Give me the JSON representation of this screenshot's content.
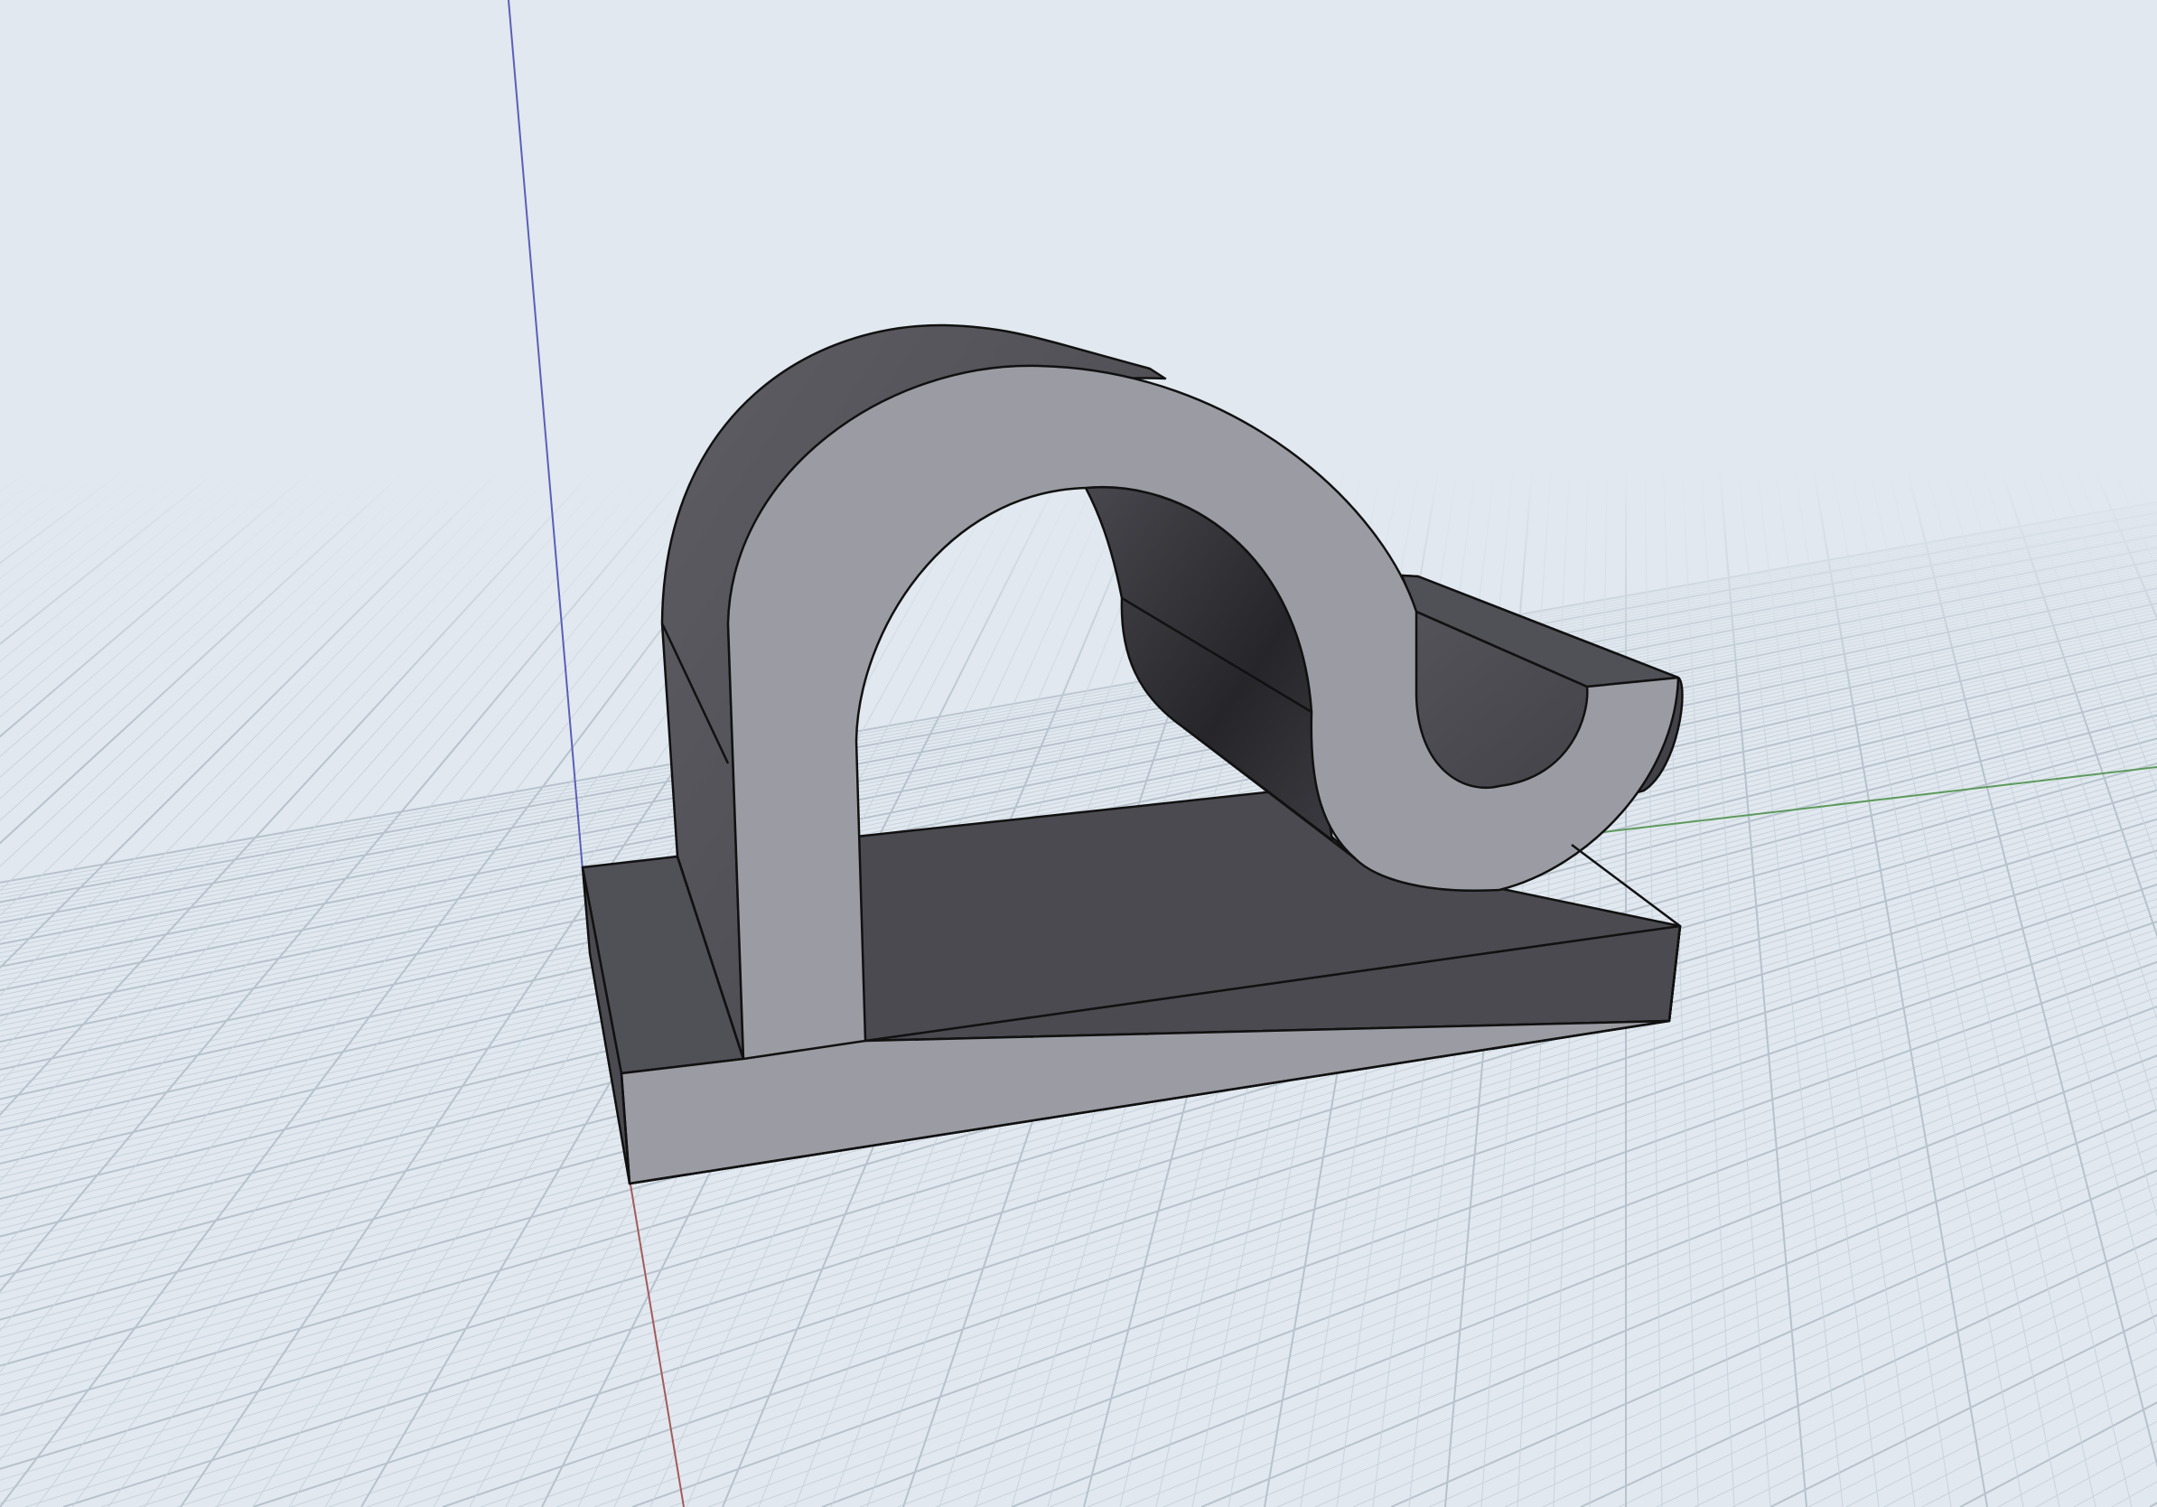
{
  "viewport": {
    "background_color": "#e1e8ef",
    "grid": {
      "visible": true,
      "minor_line_color": "#c9d3dc",
      "major_line_color": "#b7c2cc"
    },
    "axes": {
      "x_axis_color": "#a35a5a",
      "y_axis_color": "#5c9a5c",
      "z_axis_color": "#5a5fb8"
    }
  },
  "model": {
    "name": "cable-clip",
    "outline_color": "#111111",
    "front_face_color": "#9b9ca3",
    "side_face_color": "#4a4a50",
    "top_face_color": "#505057",
    "inner_curve_color": "#2c2c31"
  }
}
